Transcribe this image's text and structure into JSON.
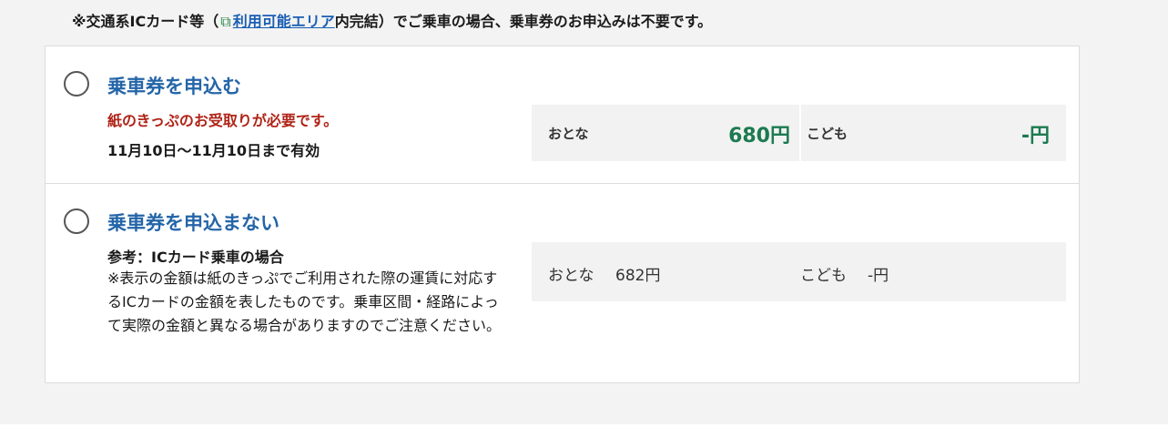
{
  "notice": {
    "prefix": "※交通系ICカード等（",
    "link_label": "利用可能エリア",
    "suffix": "内完結）でご乗車の場合、乗車券のお申込みは不要です。"
  },
  "options": {
    "apply": {
      "title": "乗車券を申込む",
      "warning": "紙のきっぷのお受取りが必要です。",
      "validity": "11月10日〜11月10日まで有効",
      "adult_label": "おとな",
      "adult_fare": "680円",
      "child_label": "こども",
      "child_fare": "-円"
    },
    "no_apply": {
      "title": "乗車券を申込まない",
      "reference_title": "参考：ICカード乗車の場合",
      "reference_body": "※表示の金額は紙のきっぷでご利用された際の運賃に対応するICカードの金額を表したものです。乗車区間・経路によって実際の金額と異なる場合がありますのでご注意ください。",
      "adult_label": "おとな",
      "adult_fare": "682円",
      "child_label": "こども",
      "child_fare": "-円"
    }
  },
  "colors": {
    "title_blue": "#2465a8",
    "warning_red": "#b02418",
    "fare_green": "#1c7a50",
    "link_blue": "#1a5fb4"
  }
}
